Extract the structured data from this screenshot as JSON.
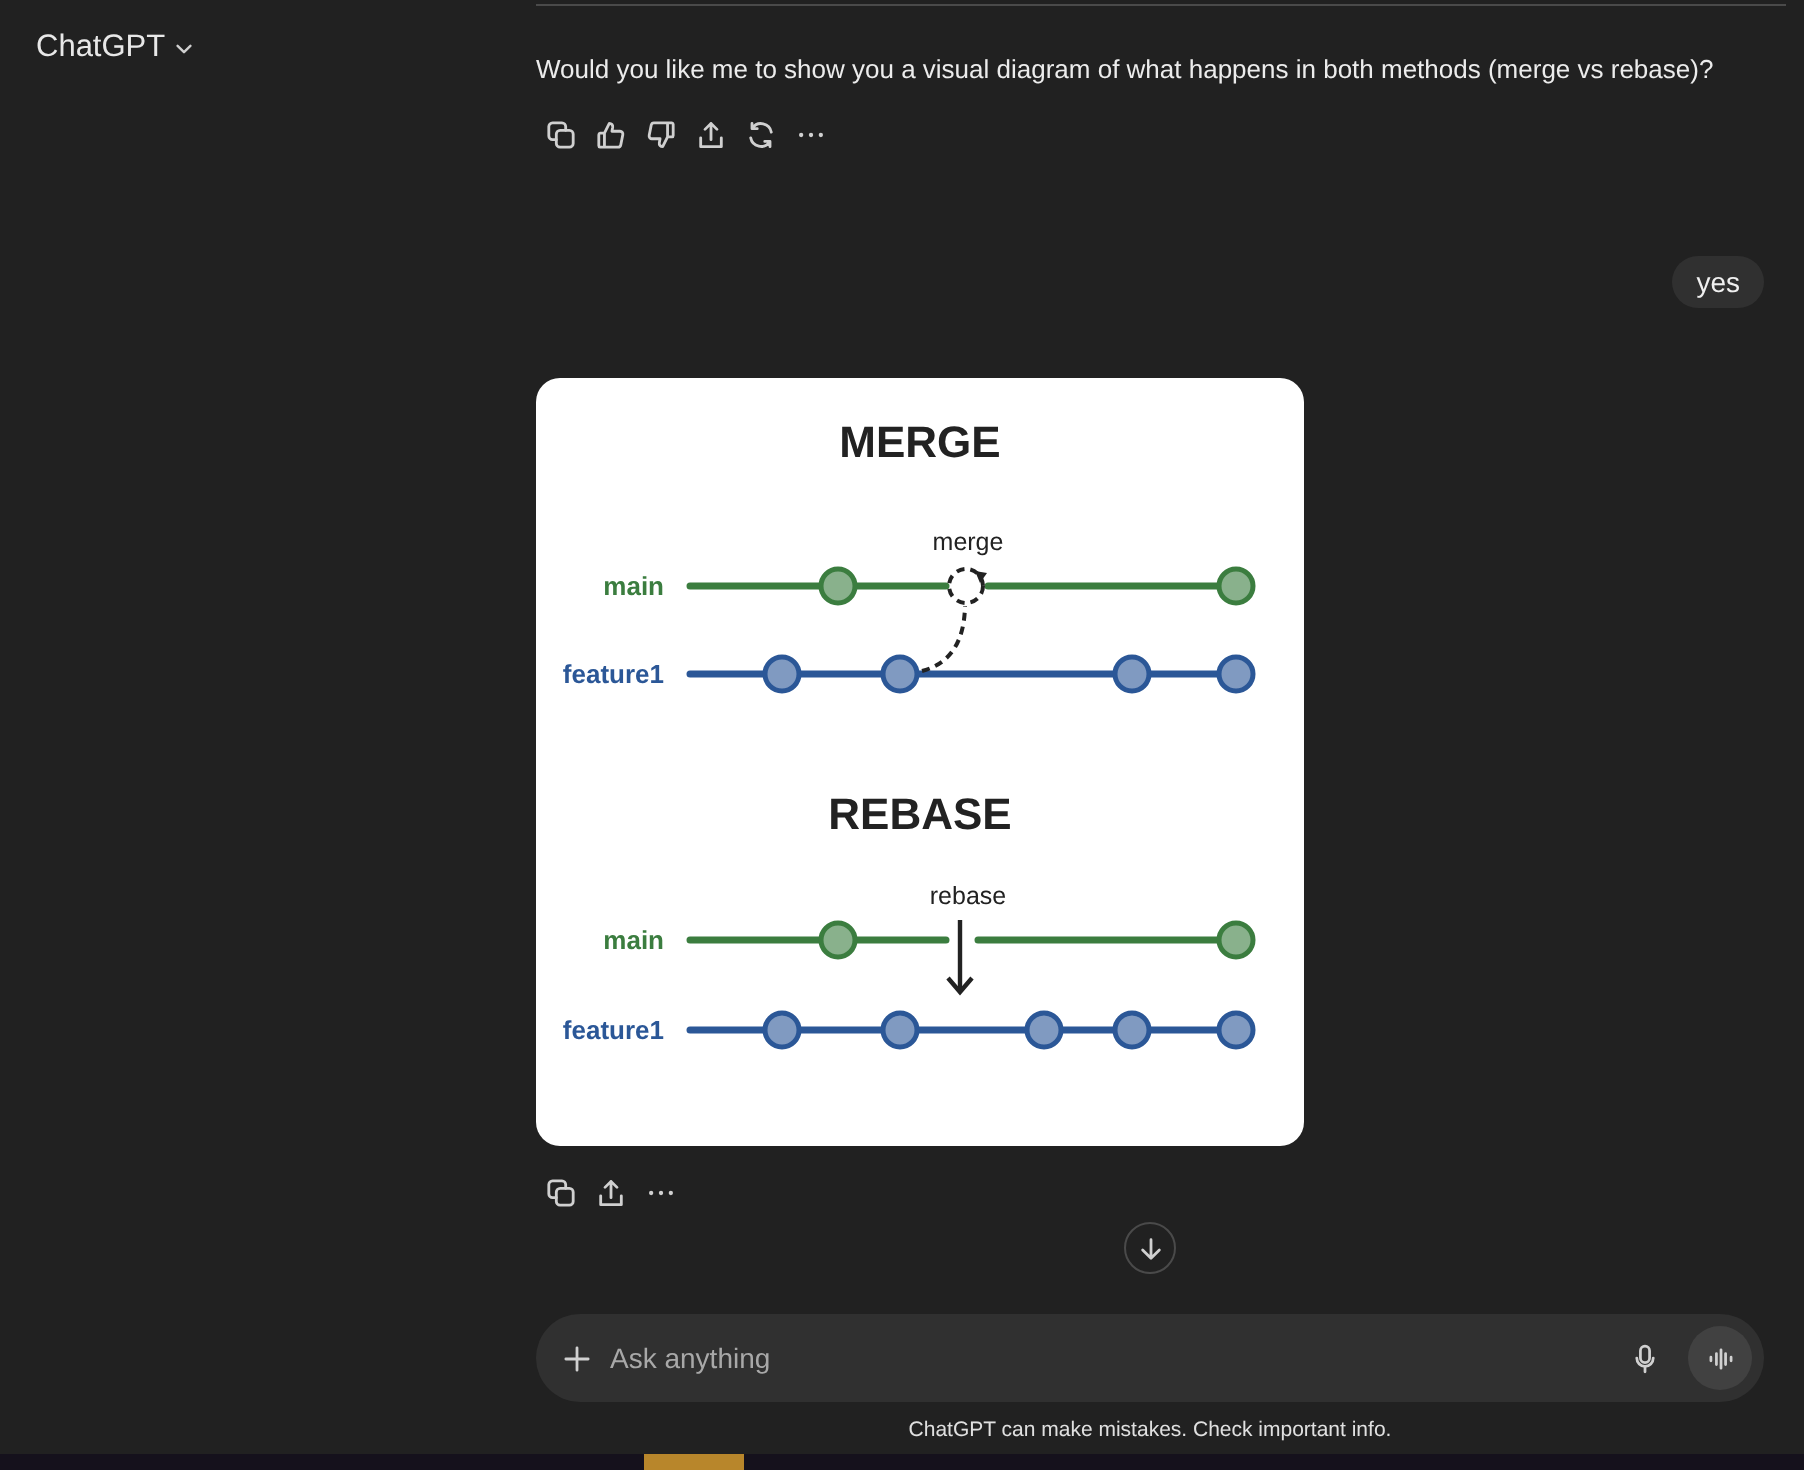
{
  "header": {
    "title": "ChatGPT"
  },
  "messages": [
    {
      "kind": "assistant_text",
      "text": "Would you like me to show you a visual diagram of what happens in both methods (merge vs rebase)?"
    },
    {
      "kind": "user",
      "text": "yes"
    },
    {
      "kind": "assistant_image",
      "diagram": {
        "panels": [
          {
            "kind": "merge",
            "title": "MERGE",
            "action_label": "merge",
            "branches": [
              {
                "label": "main",
                "color": "#3b7d3f"
              },
              {
                "label": "feature1",
                "color": "#2b5797"
              }
            ]
          },
          {
            "kind": "rebase",
            "title": "REBASE",
            "action_label": "rebase",
            "branches": [
              {
                "label": "main",
                "color": "#3b7d3f"
              },
              {
                "label": "feature1",
                "color": "#2b5797"
              }
            ]
          }
        ]
      }
    }
  ],
  "composer": {
    "placeholder": "Ask anything"
  },
  "disclaimer": "ChatGPT can make mistakes. Check important info."
}
